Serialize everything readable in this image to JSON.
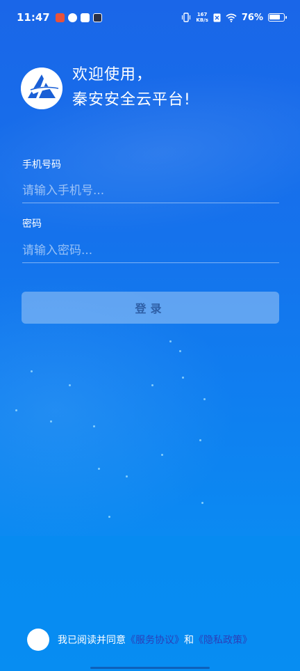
{
  "status_bar": {
    "time": "11:47",
    "net_speed_value": "167",
    "net_speed_unit": "KB/s",
    "battery_percent": "76%",
    "icons": [
      "vibrate-icon",
      "sim-icon",
      "wifi-icon",
      "battery-icon"
    ]
  },
  "header": {
    "welcome_line1": "欢迎使用，",
    "welcome_line2": "秦安安全云平台!"
  },
  "form": {
    "phone_label": "手机号码",
    "phone_placeholder": "请输入手机号...",
    "phone_value": "",
    "password_label": "密码",
    "password_placeholder": "请输入密码...",
    "password_value": "",
    "login_label": "登录"
  },
  "agreement": {
    "prefix": "我已阅读并同意",
    "service_link": "《服务协议》",
    "connector": "和",
    "privacy_link": "《隐私政策》",
    "checked": false
  },
  "colors": {
    "background_top": "#1a66e8",
    "background_bottom": "#0b8ef3",
    "link": "#2b3fb8",
    "button_text": "#2e5fa6"
  }
}
